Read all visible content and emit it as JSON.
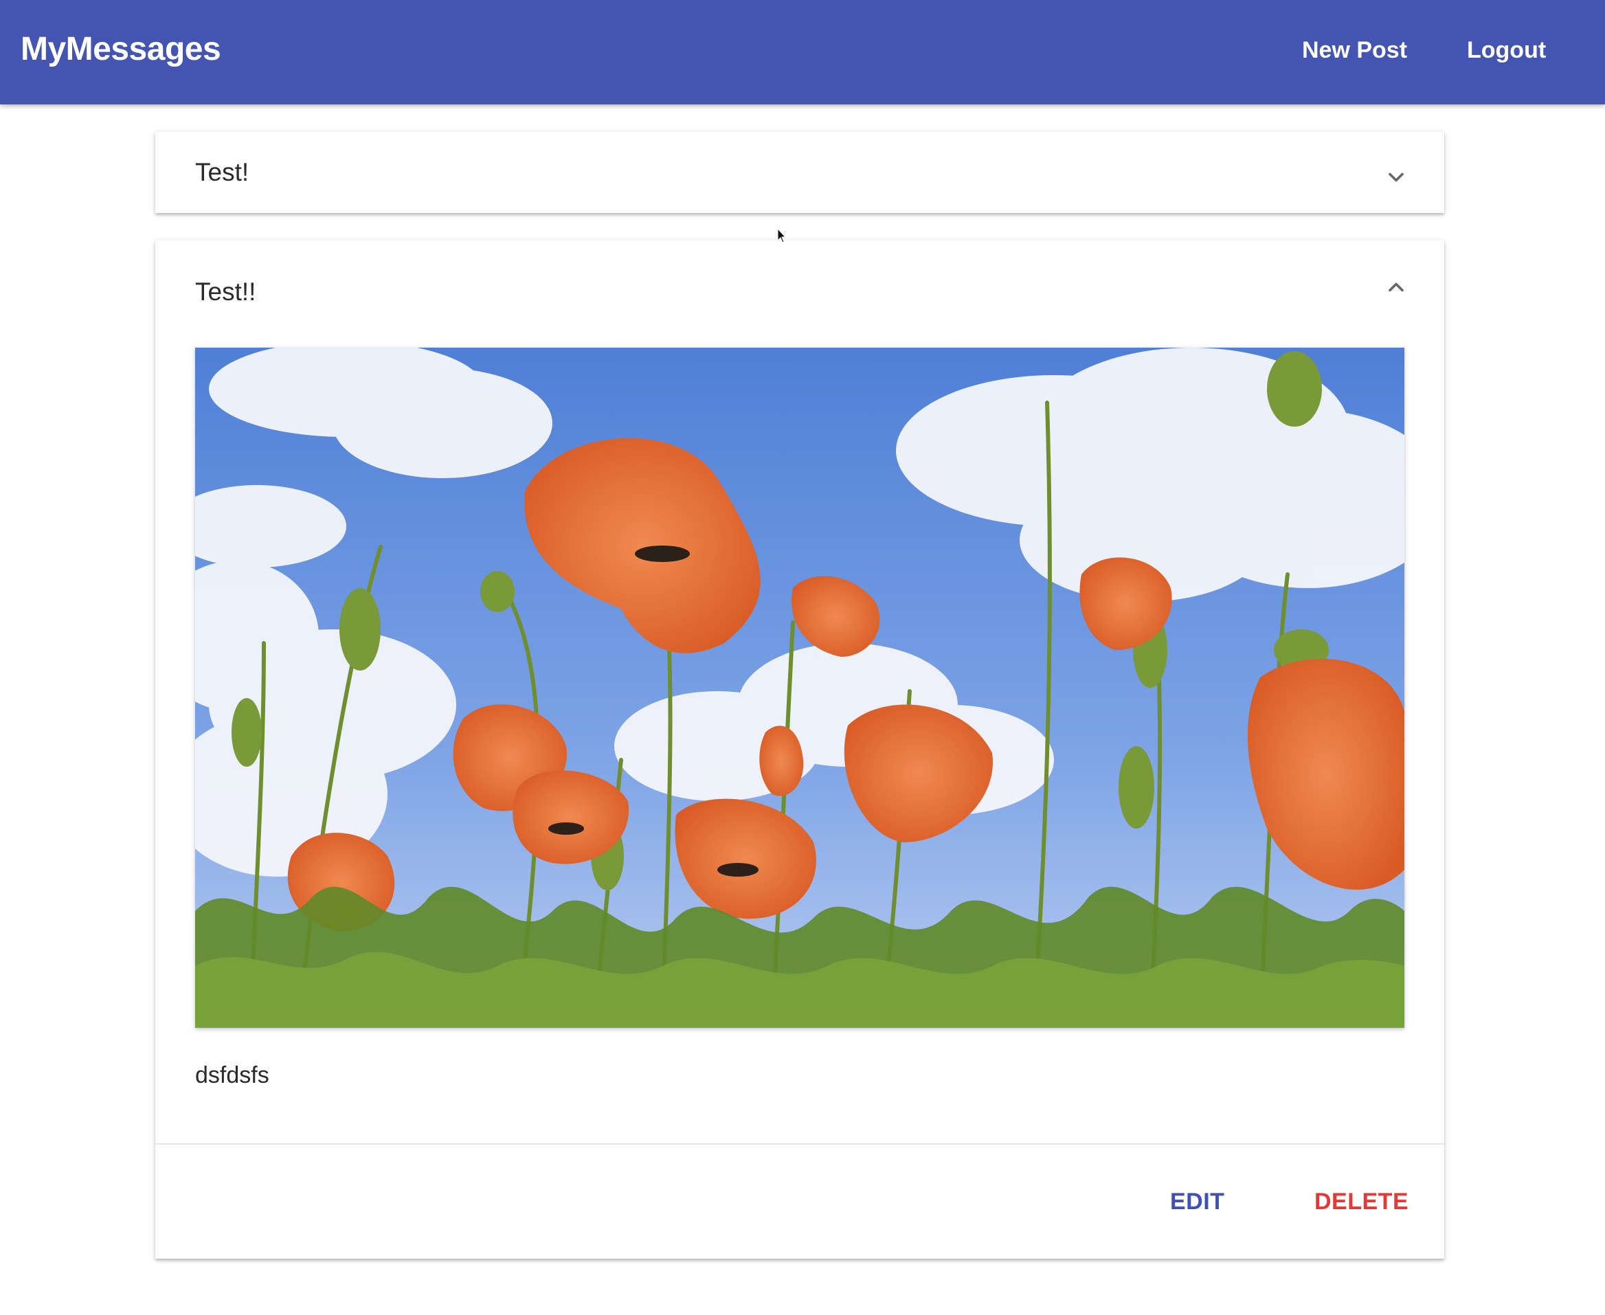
{
  "header": {
    "app_title": "MyMessages",
    "new_post_label": "New Post",
    "logout_label": "Logout",
    "color": "#4355b1"
  },
  "posts": [
    {
      "title": "Test!",
      "expanded": false,
      "icon": "chevron-down-icon"
    },
    {
      "title": "Test!!",
      "expanded": true,
      "icon": "chevron-up-icon",
      "image_alt": "Red poppies against a blue cloudy sky",
      "content": "dsfdsfs",
      "edit_label": "EDIT",
      "delete_label": "DELETE"
    }
  ],
  "colors": {
    "primary": "#3f51b5",
    "warn": "#e53935"
  }
}
